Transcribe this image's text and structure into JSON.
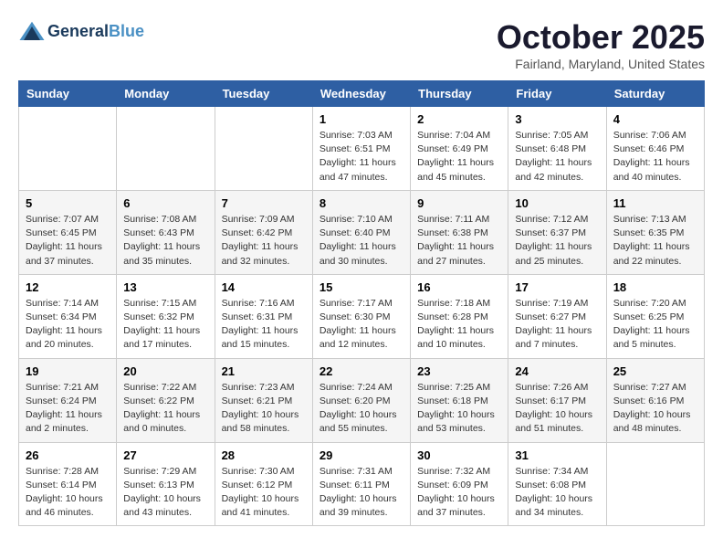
{
  "header": {
    "logo_line1": "General",
    "logo_line2": "Blue",
    "month": "October 2025",
    "location": "Fairland, Maryland, United States"
  },
  "weekdays": [
    "Sunday",
    "Monday",
    "Tuesday",
    "Wednesday",
    "Thursday",
    "Friday",
    "Saturday"
  ],
  "weeks": [
    [
      {
        "day": "",
        "info": ""
      },
      {
        "day": "",
        "info": ""
      },
      {
        "day": "",
        "info": ""
      },
      {
        "day": "1",
        "info": "Sunrise: 7:03 AM\nSunset: 6:51 PM\nDaylight: 11 hours\nand 47 minutes."
      },
      {
        "day": "2",
        "info": "Sunrise: 7:04 AM\nSunset: 6:49 PM\nDaylight: 11 hours\nand 45 minutes."
      },
      {
        "day": "3",
        "info": "Sunrise: 7:05 AM\nSunset: 6:48 PM\nDaylight: 11 hours\nand 42 minutes."
      },
      {
        "day": "4",
        "info": "Sunrise: 7:06 AM\nSunset: 6:46 PM\nDaylight: 11 hours\nand 40 minutes."
      }
    ],
    [
      {
        "day": "5",
        "info": "Sunrise: 7:07 AM\nSunset: 6:45 PM\nDaylight: 11 hours\nand 37 minutes."
      },
      {
        "day": "6",
        "info": "Sunrise: 7:08 AM\nSunset: 6:43 PM\nDaylight: 11 hours\nand 35 minutes."
      },
      {
        "day": "7",
        "info": "Sunrise: 7:09 AM\nSunset: 6:42 PM\nDaylight: 11 hours\nand 32 minutes."
      },
      {
        "day": "8",
        "info": "Sunrise: 7:10 AM\nSunset: 6:40 PM\nDaylight: 11 hours\nand 30 minutes."
      },
      {
        "day": "9",
        "info": "Sunrise: 7:11 AM\nSunset: 6:38 PM\nDaylight: 11 hours\nand 27 minutes."
      },
      {
        "day": "10",
        "info": "Sunrise: 7:12 AM\nSunset: 6:37 PM\nDaylight: 11 hours\nand 25 minutes."
      },
      {
        "day": "11",
        "info": "Sunrise: 7:13 AM\nSunset: 6:35 PM\nDaylight: 11 hours\nand 22 minutes."
      }
    ],
    [
      {
        "day": "12",
        "info": "Sunrise: 7:14 AM\nSunset: 6:34 PM\nDaylight: 11 hours\nand 20 minutes."
      },
      {
        "day": "13",
        "info": "Sunrise: 7:15 AM\nSunset: 6:32 PM\nDaylight: 11 hours\nand 17 minutes."
      },
      {
        "day": "14",
        "info": "Sunrise: 7:16 AM\nSunset: 6:31 PM\nDaylight: 11 hours\nand 15 minutes."
      },
      {
        "day": "15",
        "info": "Sunrise: 7:17 AM\nSunset: 6:30 PM\nDaylight: 11 hours\nand 12 minutes."
      },
      {
        "day": "16",
        "info": "Sunrise: 7:18 AM\nSunset: 6:28 PM\nDaylight: 11 hours\nand 10 minutes."
      },
      {
        "day": "17",
        "info": "Sunrise: 7:19 AM\nSunset: 6:27 PM\nDaylight: 11 hours\nand 7 minutes."
      },
      {
        "day": "18",
        "info": "Sunrise: 7:20 AM\nSunset: 6:25 PM\nDaylight: 11 hours\nand 5 minutes."
      }
    ],
    [
      {
        "day": "19",
        "info": "Sunrise: 7:21 AM\nSunset: 6:24 PM\nDaylight: 11 hours\nand 2 minutes."
      },
      {
        "day": "20",
        "info": "Sunrise: 7:22 AM\nSunset: 6:22 PM\nDaylight: 11 hours\nand 0 minutes."
      },
      {
        "day": "21",
        "info": "Sunrise: 7:23 AM\nSunset: 6:21 PM\nDaylight: 10 hours\nand 58 minutes."
      },
      {
        "day": "22",
        "info": "Sunrise: 7:24 AM\nSunset: 6:20 PM\nDaylight: 10 hours\nand 55 minutes."
      },
      {
        "day": "23",
        "info": "Sunrise: 7:25 AM\nSunset: 6:18 PM\nDaylight: 10 hours\nand 53 minutes."
      },
      {
        "day": "24",
        "info": "Sunrise: 7:26 AM\nSunset: 6:17 PM\nDaylight: 10 hours\nand 51 minutes."
      },
      {
        "day": "25",
        "info": "Sunrise: 7:27 AM\nSunset: 6:16 PM\nDaylight: 10 hours\nand 48 minutes."
      }
    ],
    [
      {
        "day": "26",
        "info": "Sunrise: 7:28 AM\nSunset: 6:14 PM\nDaylight: 10 hours\nand 46 minutes."
      },
      {
        "day": "27",
        "info": "Sunrise: 7:29 AM\nSunset: 6:13 PM\nDaylight: 10 hours\nand 43 minutes."
      },
      {
        "day": "28",
        "info": "Sunrise: 7:30 AM\nSunset: 6:12 PM\nDaylight: 10 hours\nand 41 minutes."
      },
      {
        "day": "29",
        "info": "Sunrise: 7:31 AM\nSunset: 6:11 PM\nDaylight: 10 hours\nand 39 minutes."
      },
      {
        "day": "30",
        "info": "Sunrise: 7:32 AM\nSunset: 6:09 PM\nDaylight: 10 hours\nand 37 minutes."
      },
      {
        "day": "31",
        "info": "Sunrise: 7:34 AM\nSunset: 6:08 PM\nDaylight: 10 hours\nand 34 minutes."
      },
      {
        "day": "",
        "info": ""
      }
    ]
  ]
}
